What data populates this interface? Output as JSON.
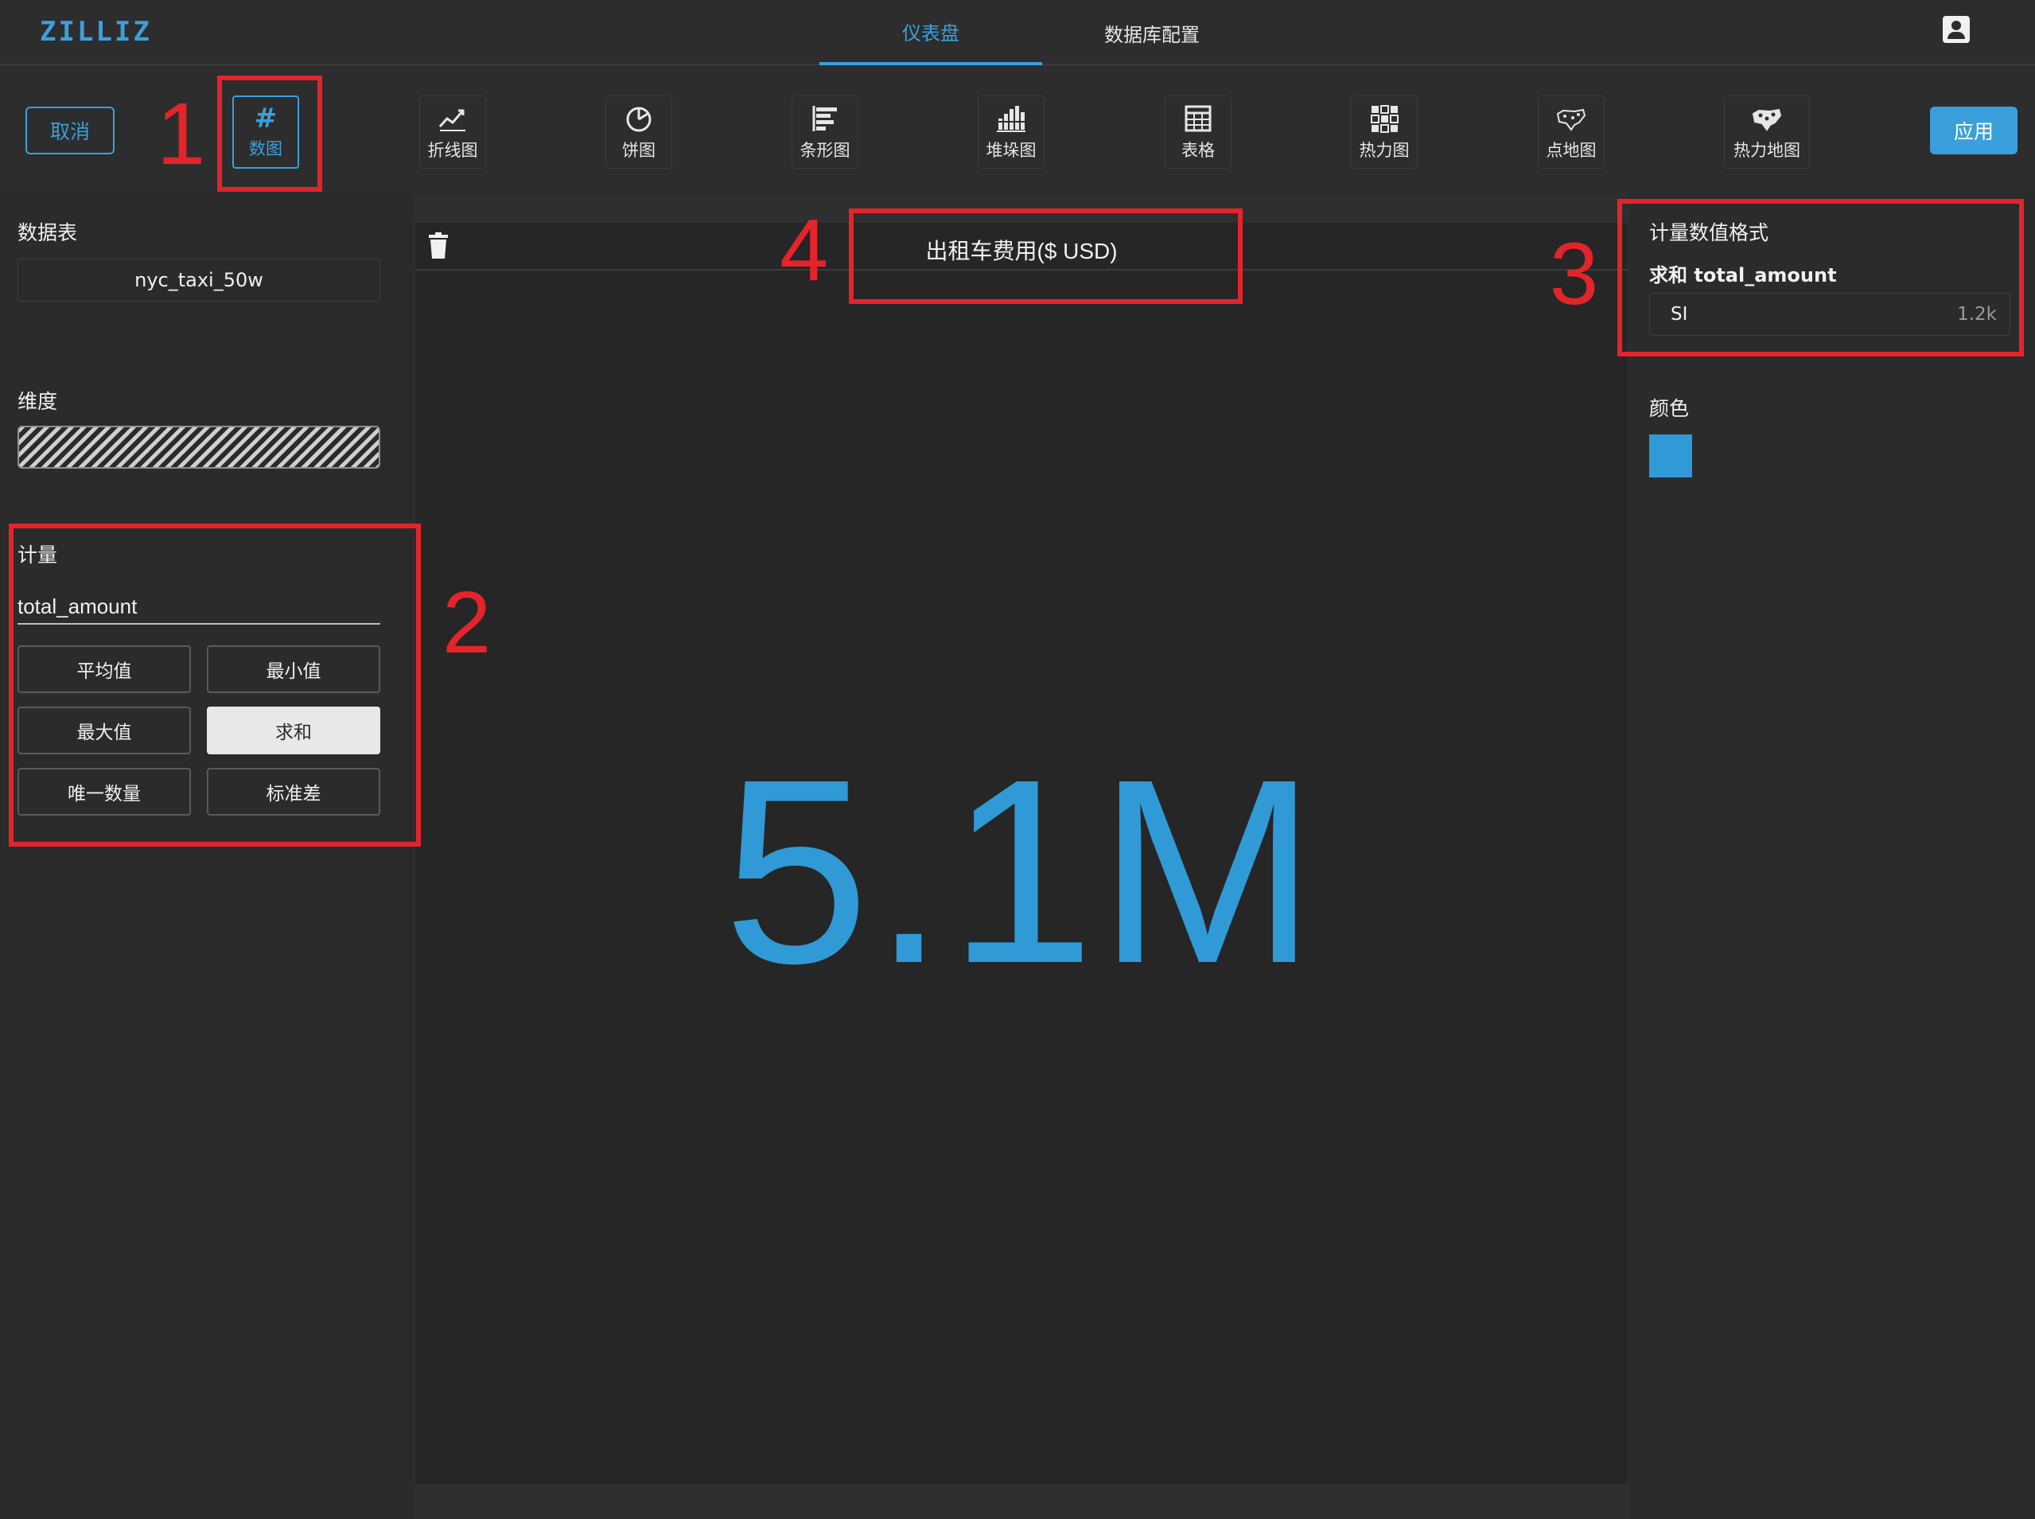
{
  "app": {
    "logo": "ZILLIZ",
    "nav_tabs": [
      {
        "label": "仪表盘",
        "active": true
      },
      {
        "label": "数据库配置",
        "active": false
      }
    ]
  },
  "toolbar": {
    "cancel_label": "取消",
    "apply_label": "应用",
    "chart_types": [
      {
        "label": "数图",
        "icon": "number-icon",
        "active": true
      },
      {
        "label": "折线图",
        "icon": "line-chart-icon"
      },
      {
        "label": "饼图",
        "icon": "pie-chart-icon"
      },
      {
        "label": "条形图",
        "icon": "bar-chart-icon"
      },
      {
        "label": "堆垛图",
        "icon": "stacked-chart-icon"
      },
      {
        "label": "表格",
        "icon": "table-icon"
      },
      {
        "label": "热力图",
        "icon": "heatmap-icon"
      },
      {
        "label": "点地图",
        "icon": "point-map-icon"
      },
      {
        "label": "热力地图",
        "icon": "heat-map-icon"
      }
    ]
  },
  "left_panel": {
    "table_label": "数据表",
    "table_value": "nyc_taxi_50w",
    "dimension_label": "维度",
    "measure_label": "计量",
    "measure_field": "total_amount",
    "aggregations": [
      {
        "label": "平均值",
        "active": false
      },
      {
        "label": "最小值",
        "active": false
      },
      {
        "label": "最大值",
        "active": false
      },
      {
        "label": "求和",
        "active": true
      },
      {
        "label": "唯一数量",
        "active": false
      },
      {
        "label": "标准差",
        "active": false
      }
    ]
  },
  "center": {
    "chart_title": "出租车费用($ USD)",
    "value": "5.1M"
  },
  "right_panel": {
    "format_label": "计量数值格式",
    "format_measure": "求和 total_amount",
    "format_name": "SI",
    "format_example": "1.2k",
    "color_label": "颜色",
    "color": "#2f9ad6"
  },
  "annotations": [
    "1",
    "2",
    "3",
    "4"
  ],
  "colors": {
    "accent": "#3aa0dc",
    "annotation": "#e3242b",
    "background": "#2f2f2f"
  }
}
